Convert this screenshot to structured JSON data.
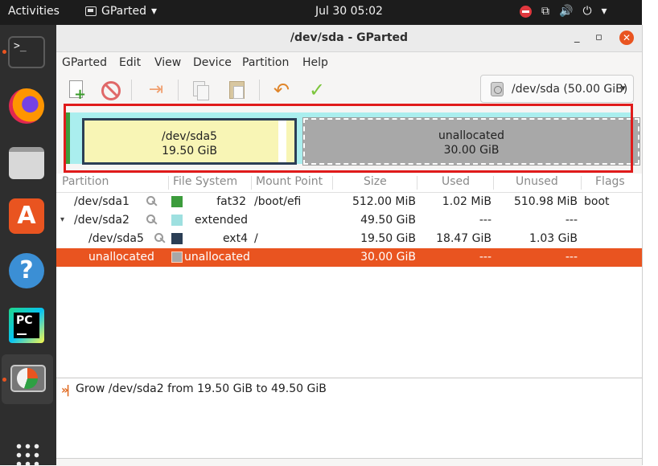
{
  "topbar": {
    "activities": "Activities",
    "app_name": "GParted",
    "app_arrow": "▾",
    "clock": "Jul 30  05:02",
    "network_icon": "⧉",
    "volume_icon": "🔊",
    "power_icon": "⏻",
    "power_arrow": "▾"
  },
  "dock": {
    "terminal_label": ">_",
    "store_label": "A",
    "help_label": "?",
    "pycharm_label": "PC"
  },
  "window": {
    "title": "/dev/sda - GParted",
    "minimize": "_",
    "maximize": "▫",
    "close": "✕"
  },
  "menu": {
    "items": [
      "GParted",
      "Edit",
      "View",
      "Device",
      "Partition",
      "Help"
    ]
  },
  "toolbar": {
    "resize_glyph": "⇥",
    "undo_glyph": "↶",
    "apply_glyph": "✓"
  },
  "device_selector": {
    "value": "/dev/sda (50.00 GiB)",
    "arrow": "▾"
  },
  "graph": {
    "sda5_name": "/dev/sda5",
    "sda5_size": "19.50 GiB",
    "unalloc_name": "unallocated",
    "unalloc_size": "30.00 GiB"
  },
  "table": {
    "columns": [
      "Partition",
      "File System",
      "Mount Point",
      "Size",
      "Used",
      "Unused",
      "Flags"
    ],
    "rows": [
      {
        "partition": "/dev/sda1",
        "filesystem": "fat32",
        "mount": "/boot/efi",
        "size": "512.00 MiB",
        "used": "1.02 MiB",
        "unused": "510.98 MiB",
        "flags": "boot",
        "color": "#3c9c3c"
      },
      {
        "partition": "/dev/sda2",
        "filesystem": "extended",
        "mount": "",
        "size": "49.50 GiB",
        "used": "---",
        "unused": "---",
        "flags": "",
        "color": "#9ee0e0",
        "expander": "▾"
      },
      {
        "partition": "/dev/sda5",
        "filesystem": "ext4",
        "mount": "/",
        "size": "19.50 GiB",
        "used": "18.47 GiB",
        "unused": "1.03 GiB",
        "flags": "",
        "color": "#2b3e55"
      },
      {
        "partition": "unallocated",
        "filesystem": "unallocated",
        "mount": "",
        "size": "30.00 GiB",
        "used": "---",
        "unused": "---",
        "flags": "",
        "color": "#a8a8a8"
      }
    ]
  },
  "operations": {
    "icon": "»|",
    "items": [
      "Grow /dev/sda2 from 19.50 GiB to 49.50 GiB"
    ]
  },
  "colors": {
    "accent": "#e95420",
    "highlight": "#e01b1b",
    "sda5_fill": "#f8f5b5",
    "extended": "#aaeeee",
    "unallocated": "#a8a8a8"
  }
}
